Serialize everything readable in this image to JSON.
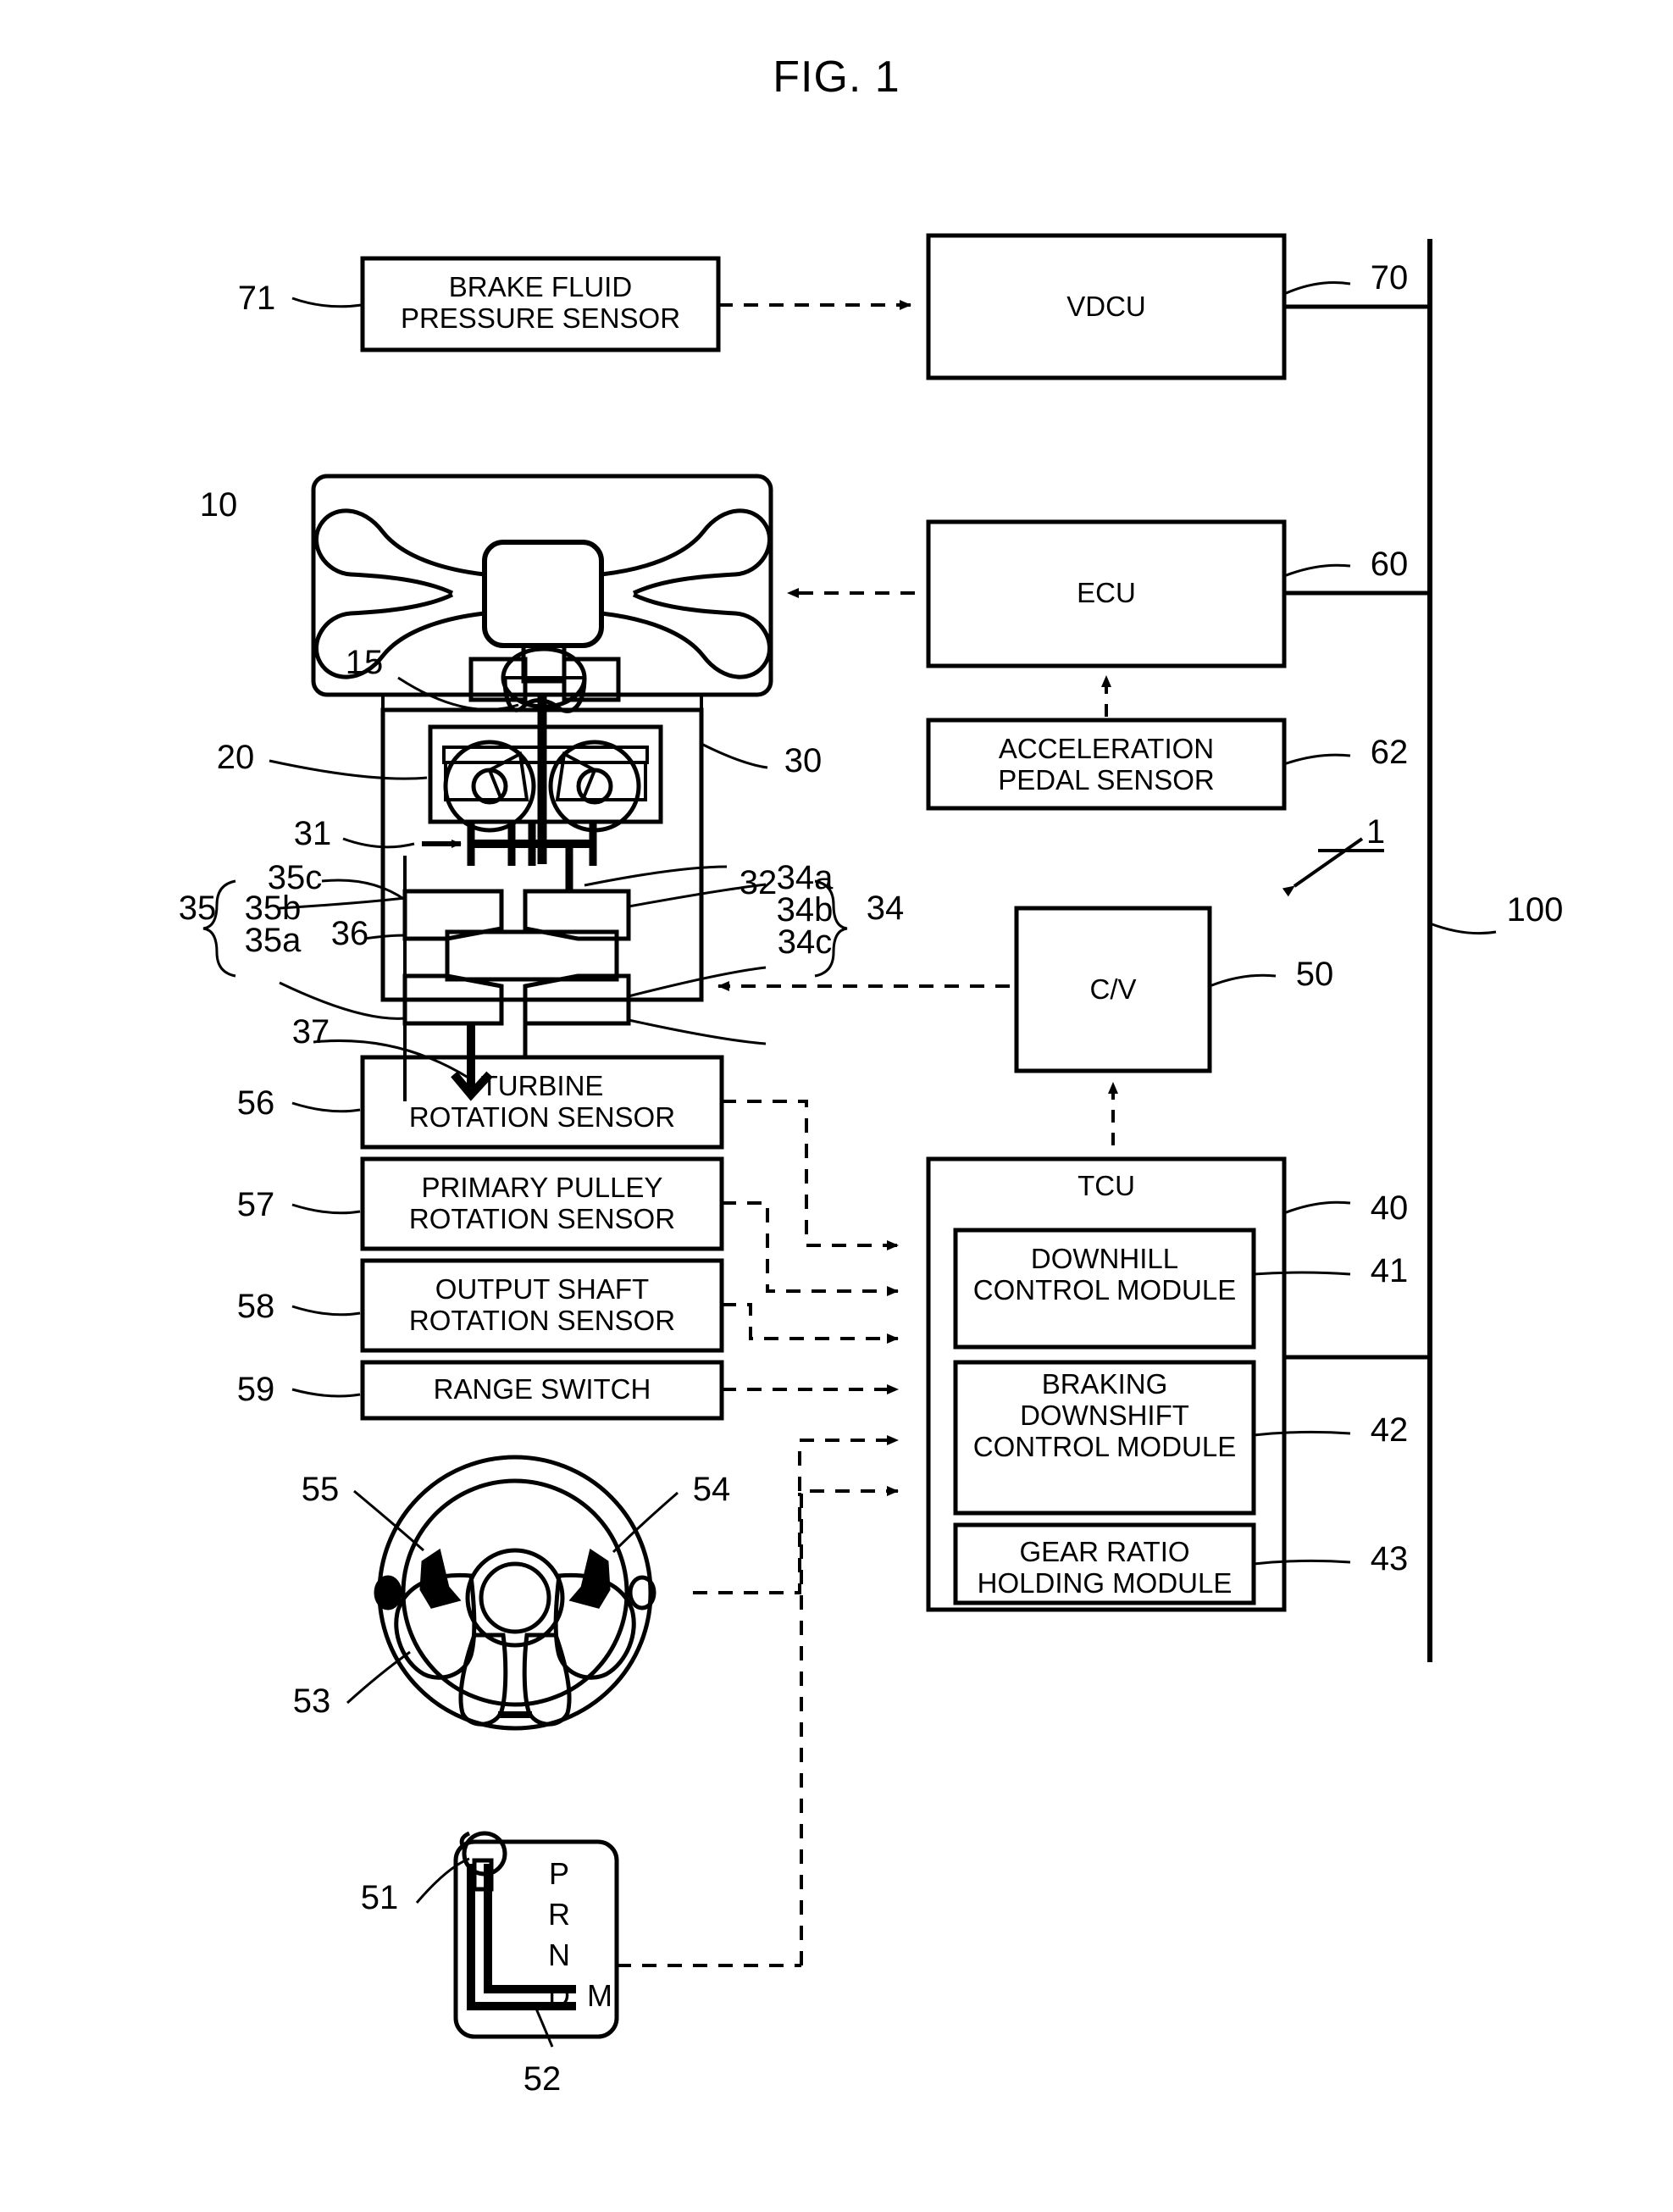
{
  "figure": {
    "title": "FIG. 1",
    "type": "patent-block-diagram",
    "subject": "Vehicle continuously variable transmission control system"
  },
  "blocks": {
    "brake_fluid_pressure_sensor": {
      "label": "BRAKE FLUID\nPRESSURE SENSOR",
      "ref": "71"
    },
    "vdcu": {
      "label": "VDCU",
      "ref": "70"
    },
    "engine": {
      "label": "",
      "ref": "10",
      "inner_ref": "15"
    },
    "torque_converter": {
      "label": "",
      "ref": "20"
    },
    "transmission": {
      "label": "",
      "ref": "30"
    },
    "ecu": {
      "label": "ECU",
      "ref": "60"
    },
    "acceleration_pedal_sensor": {
      "label": "ACCELERATION\nPEDAL SENSOR",
      "ref": "62"
    },
    "control_valve": {
      "label": "C/V",
      "ref": "50"
    },
    "turbine_rotation_sensor": {
      "label": "TURBINE\nROTATION SENSOR",
      "ref": "56"
    },
    "primary_pulley_rotation_sensor": {
      "label": "PRIMARY PULLEY\nROTATION SENSOR",
      "ref": "57"
    },
    "output_shaft_rotation_sensor": {
      "label": "OUTPUT SHAFT\nROTATION SENSOR",
      "ref": "58"
    },
    "range_switch": {
      "label": "RANGE SWITCH",
      "ref": "59"
    },
    "tcu": {
      "label": "TCU",
      "ref": "40"
    },
    "downhill_control_module": {
      "label": "DOWNHILL\nCONTROL MODULE",
      "ref": "41"
    },
    "braking_downshift_control_module": {
      "label": "BRAKING\nDOWNSHIFT\nCONTROL MODULE",
      "ref": "42"
    },
    "gear_ratio_holding_module": {
      "label": "GEAR RATIO\nHOLDING MODULE",
      "ref": "43"
    },
    "steering_wheel": {
      "ref": "53"
    },
    "paddle_right": {
      "ref": "54"
    },
    "paddle_left": {
      "ref": "55"
    },
    "shift_lever": {
      "ref": "51"
    },
    "shift_gate": {
      "ref": "52",
      "positions": "P\nR\nN\nD",
      "manual_position": "M"
    },
    "system": {
      "ref": "1"
    },
    "vehicle_bus": {
      "ref": "100"
    }
  },
  "transmission_parts": {
    "input_shaft": "31",
    "gear_set": "32",
    "primary_pulley": "34",
    "primary_pulley_a": "34a",
    "primary_pulley_b": "34b",
    "primary_pulley_c": "34c",
    "secondary_pulley": "35",
    "secondary_pulley_a": "35a",
    "secondary_pulley_b": "35b",
    "secondary_pulley_c": "35c",
    "belt": "36",
    "output_shaft": "37"
  },
  "refs": {
    "r1": "1",
    "r10": "10",
    "r15": "15",
    "r20": "20",
    "r30": "30",
    "r31": "31",
    "r32": "32",
    "r34": "34",
    "r34a": "34a",
    "r34b": "34b",
    "r34c": "34c",
    "r35": "35",
    "r35a": "35a",
    "r35b": "35b",
    "r35c": "35c",
    "r36": "36",
    "r37": "37",
    "r40": "40",
    "r41": "41",
    "r42": "42",
    "r43": "43",
    "r50": "50",
    "r51": "51",
    "r52": "52",
    "r53": "53",
    "r54": "54",
    "r55": "55",
    "r56": "56",
    "r57": "57",
    "r58": "58",
    "r59": "59",
    "r60": "60",
    "r62": "62",
    "r70": "70",
    "r71": "71",
    "r100": "100"
  },
  "gate_text": {
    "p": "P",
    "r": "R",
    "n": "N",
    "d": "D",
    "m": "M"
  },
  "colors": {
    "ink": "#000000",
    "paper": "#ffffff"
  }
}
